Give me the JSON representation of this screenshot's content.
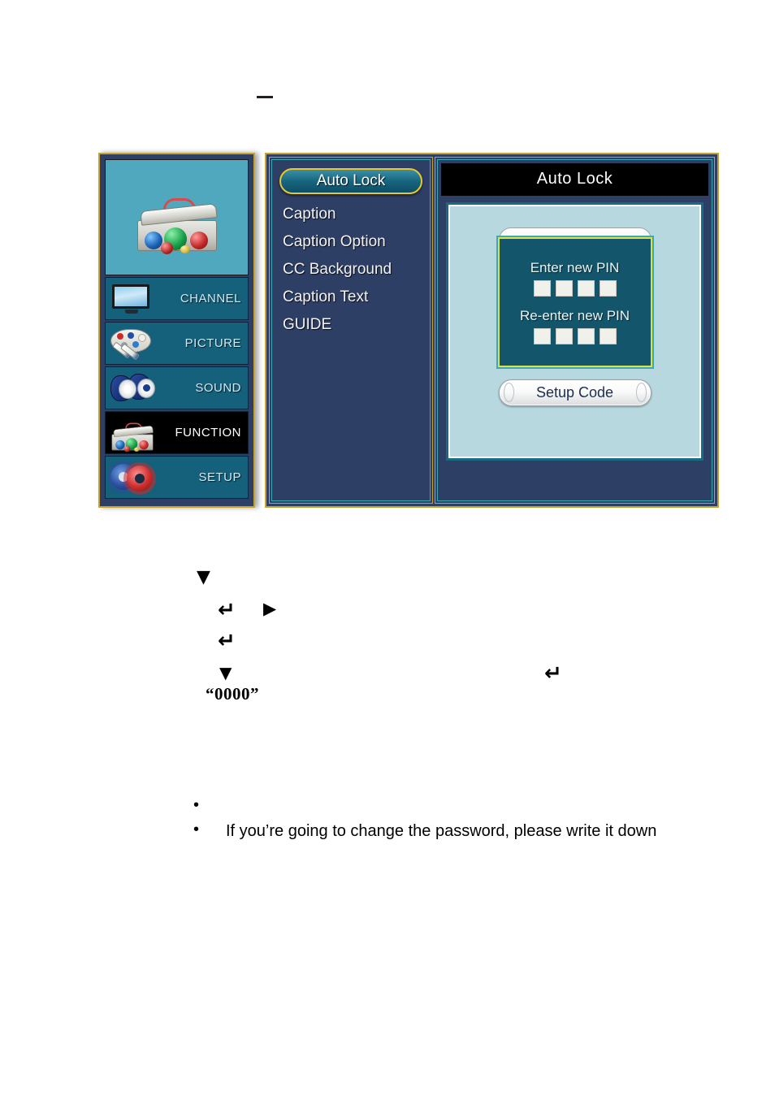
{
  "page": {
    "dash_mark": "–",
    "glyphs": {
      "down_arrow": "▼",
      "enter_return": "↵",
      "right_arrow": "▶"
    },
    "default_pin_text": "“0000”",
    "bullets": [
      "",
      "If you’re going to change the password, please write it down"
    ]
  },
  "osd": {
    "sidebar": {
      "hero_icon": "toolbox-icon",
      "items": [
        {
          "label": "CHANNEL",
          "icon": "tv-icon",
          "selected": false
        },
        {
          "label": "PICTURE",
          "icon": "palette-icon",
          "selected": false
        },
        {
          "label": "SOUND",
          "icon": "speaker-icon",
          "selected": false
        },
        {
          "label": "FUNCTION",
          "icon": "toolbox-icon",
          "selected": true
        },
        {
          "label": "SETUP",
          "icon": "gears-icon",
          "selected": false
        }
      ]
    },
    "menu": {
      "items": [
        {
          "label": "Auto Lock",
          "highlighted": true
        },
        {
          "label": "Caption",
          "highlighted": false
        },
        {
          "label": "Caption Option",
          "highlighted": false
        },
        {
          "label": "CC Background",
          "highlighted": false
        },
        {
          "label": "Caption Text",
          "highlighted": false
        },
        {
          "label": "GUIDE",
          "highlighted": false
        }
      ]
    },
    "detail": {
      "title": "Auto Lock",
      "obscured_button_label": "",
      "pin_dialog": {
        "enter_label": "Enter new PIN",
        "reenter_label": "Re-enter new PIN",
        "digit_count": 4,
        "enter_values": [
          "",
          "",
          "",
          ""
        ],
        "reenter_values": [
          "",
          "",
          "",
          ""
        ]
      },
      "setup_code_label": "Setup Code"
    }
  },
  "colors": {
    "panel_bg": "#2e3f66",
    "panel_border_gold": "#c9a22a",
    "panel_border_cyan": "#3aa9b5",
    "sidebar_item_bg": "#15607a",
    "sidebar_hero_bg": "#4fa8bd",
    "selected_item_bg": "#000000",
    "detail_body_bg": "#b6d8de",
    "pin_dialog_bg": "#13566b",
    "highlight_border": "#e8c82a"
  }
}
